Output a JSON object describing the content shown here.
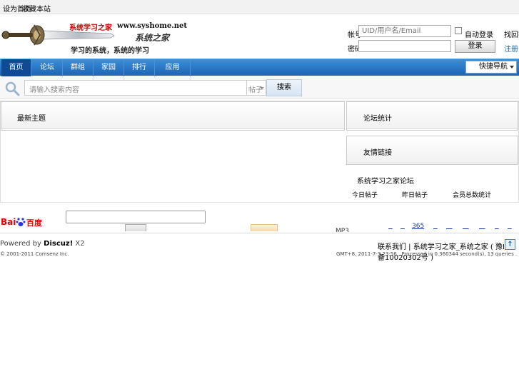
{
  "topbar": {
    "links": [
      "设为首页",
      "收藏本站"
    ]
  },
  "header": {
    "site_name_1": "系统学习之家",
    "domain": "www.syshome.net",
    "site_name_2": "系统之家",
    "slogan": "学习的系统，系统的学习"
  },
  "login": {
    "user_label": "帐号",
    "user_placeholder": "UID/用户名/Email",
    "remember_label": "自动登录",
    "forgot_label": "找回密码",
    "password_label": "密码",
    "login_button": "登录",
    "register_label": "注册"
  },
  "nav": {
    "items": [
      "首页",
      "论坛",
      "群组",
      "家园",
      "排行",
      "应用"
    ],
    "quick_nav": "快捷导航"
  },
  "search": {
    "placeholder": "请输入搜索内容",
    "scope": "帖子",
    "button": "搜索"
  },
  "panels": {
    "main_title": "最新主题",
    "side_title_1": "论坛统计",
    "side_title_2": "友情链接",
    "stats_line": "系统学习之家论坛",
    "stats": [
      "今日帖子",
      "昨日帖子",
      "会员总数统计"
    ]
  },
  "baidu": {
    "logo_bai": "Bai",
    "logo_du": "百度"
  },
  "links_strip": {
    "mp3": "MP3",
    "item": "365"
  },
  "footer": {
    "powered": "Powered by ",
    "brand": "Discuz!",
    "version": " X2",
    "copyright": "© 2001-2011 Comsenz Inc.",
    "links": "联系我们 | 系统学习之家_系统之家 ( 豫ICP备10020302号 )",
    "status": "GMT+8, 2011-7-3 23:56 , Processed in 0.360344 second(s), 13 queries .",
    "top_button": "↑"
  },
  "colors": {
    "nav_blue": "#1d63b4",
    "accent_red": "#cc0000"
  }
}
